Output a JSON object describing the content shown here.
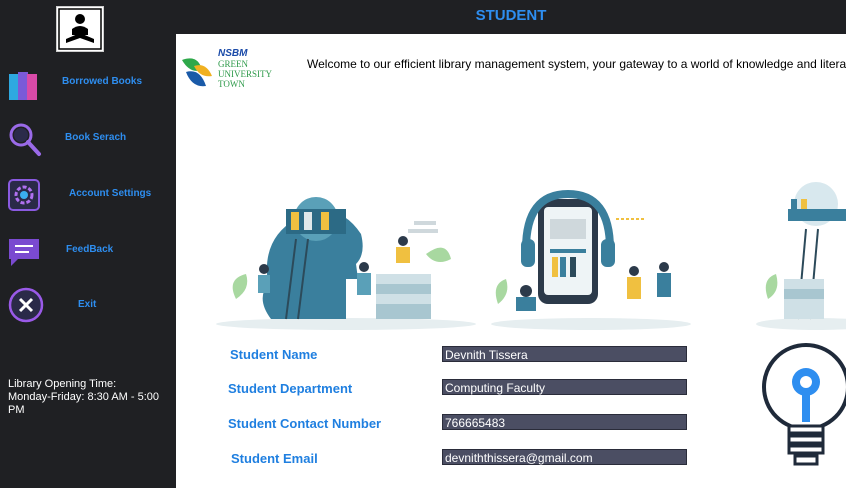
{
  "header": {
    "title": "STUDENT"
  },
  "sidebar": {
    "logo_icon": "reading-person-icon",
    "items": [
      {
        "label": "Borrowed Books",
        "icon": "books-icon"
      },
      {
        "label": "Book Serach",
        "icon": "search-icon"
      },
      {
        "label": "Account Settings",
        "icon": "gear-icon"
      },
      {
        "label": "FeedBack",
        "icon": "chat-icon"
      },
      {
        "label": "Exit",
        "icon": "close-icon"
      }
    ],
    "hours_title": "Library Opening Time:",
    "hours_value": "Monday-Friday: 8:30 AM - 5:00 PM"
  },
  "main": {
    "brand": {
      "line1": "NSBM",
      "line2": "GREEN",
      "line3": "UNIVERSITY",
      "line4": "TOWN"
    },
    "welcome": "Welcome to our efficient library management system, your gateway to a world of knowledge and literary tre",
    "fields": [
      {
        "label": "Student Name",
        "value": "Devnith Tissera"
      },
      {
        "label": "Student Department",
        "value": "Computing Faculty"
      },
      {
        "label": "Student Contact Number",
        "value": "766665483"
      },
      {
        "label": "Student Email",
        "value": "devniththissera@gmail.com"
      }
    ]
  },
  "colors": {
    "accent": "#2e8ef0",
    "sidebar_bg": "#1f2023",
    "input_bg": "#4b4e63",
    "teal": "#3a7f9d"
  }
}
